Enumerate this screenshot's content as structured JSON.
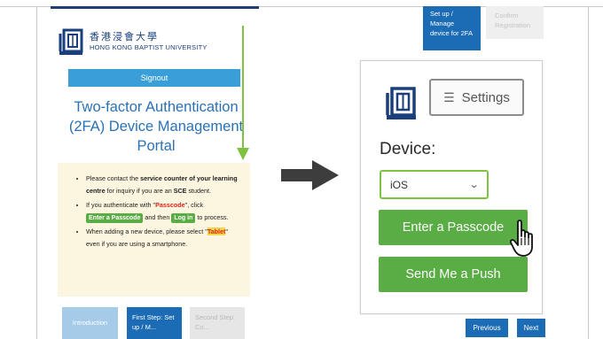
{
  "left_screen": {
    "university_name_cn": "香港浸會大學",
    "university_name_en": "HONG KONG BAPTIST UNIVERSITY",
    "signout_label": "Signout",
    "portal_title": "Two-factor Authentication (2FA) Device Management Portal",
    "notes": {
      "item1_pre": "Please contact the ",
      "item1_bold": "service counter of your learning centre",
      "item1_mid": " for inquiry if you are an ",
      "item1_sce": "SCE",
      "item1_post": " student.",
      "item2_pre": "If you authenticate with \"",
      "item2_word": "Passcode",
      "item2_mid": "\", click ",
      "item2_btn1": "Enter a Passcode",
      "item2_and": " and then ",
      "item2_btn2": "Log in",
      "item2_post": " to process.",
      "item3_pre": "When adding a new device, please select \"",
      "item3_tablet": "Tablet",
      "item3_post": "\" even if you are using a smartphone."
    },
    "steps": {
      "intro": "Introduction",
      "first": "First Step: Set up / M...",
      "second": "Second Step: Co..."
    }
  },
  "right_screen": {
    "top_step_first": "Set up / Manage device for 2FA",
    "top_step_second": "Confirm Registration",
    "settings_label": "Settings",
    "device_label": "Device:",
    "device_value": "iOS",
    "enter_passcode_label": "Enter a Passcode",
    "send_push_label": "Send Me a Push",
    "previous_label": "Previous",
    "next_label": "Next"
  },
  "colors": {
    "brand_blue": "#1b6bb5",
    "title_blue": "#2a72b5",
    "green": "#5aac44",
    "note_bg": "#fcf5df",
    "arrow_green": "#7fc241",
    "arrow_dark": "#3d3d3d"
  },
  "icons": {
    "university_logo": "hkbu-logo-icon",
    "settings_menu": "hamburger-icon",
    "select_caret": "chevron-down-icon",
    "pointer": "hand-pointer-icon",
    "scroll_arrow": "arrow-down-icon",
    "flow_arrow": "arrow-right-icon"
  }
}
